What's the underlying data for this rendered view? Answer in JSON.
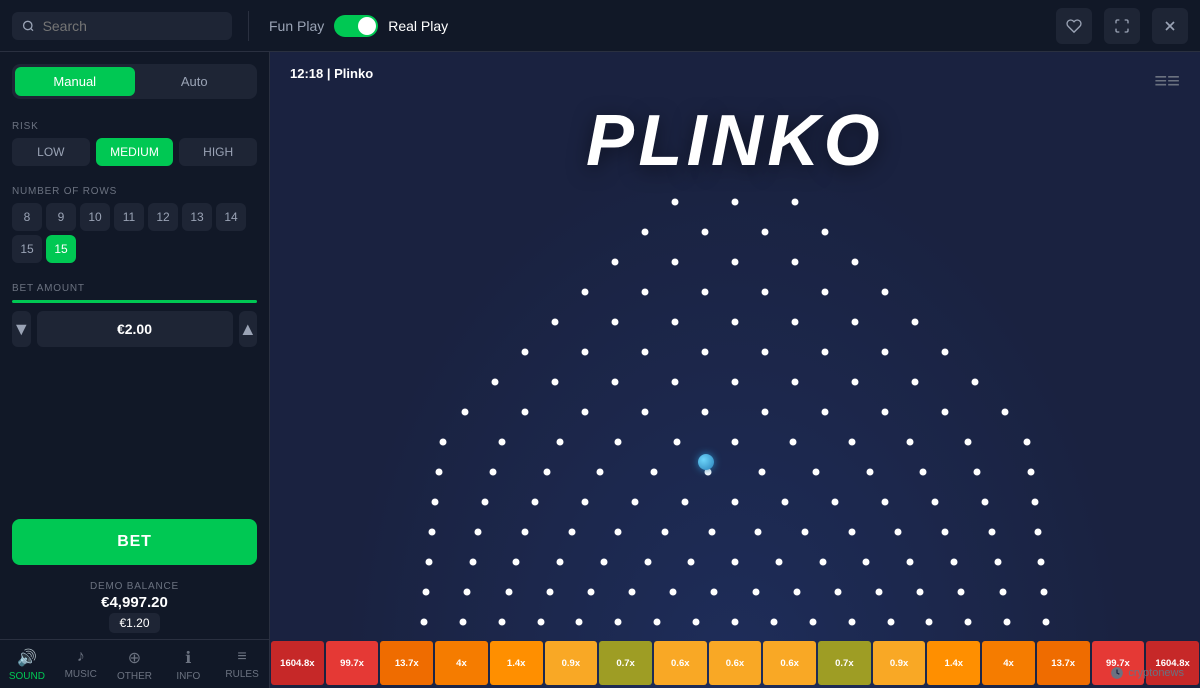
{
  "header": {
    "search_placeholder": "Search",
    "fun_play_label": "Fun Play",
    "real_play_label": "Real Play",
    "favorite_icon": "♥",
    "fullscreen_icon": "⛶",
    "close_icon": "✕"
  },
  "sidebar": {
    "manual_tab": "Manual",
    "auto_tab": "Auto",
    "risk_label": "RISK",
    "risk_options": [
      "LOW",
      "MEDIUM",
      "HIGH"
    ],
    "active_risk": "MEDIUM",
    "rows_label": "NUMBER OF ROWS",
    "row_options": [
      "8",
      "9",
      "10",
      "11",
      "12",
      "13",
      "14",
      "15",
      "15"
    ],
    "active_row": "15",
    "bet_amount_label": "BET AMOUNT",
    "bet_amount_value": "€2.00",
    "bet_button_label": "BET",
    "demo_balance_label": "DEMO BALANCE",
    "demo_balance_amount": "€4,997.20",
    "demo_badge": "€1.20",
    "nav_items": [
      {
        "label": "SOUND",
        "icon": "🔊"
      },
      {
        "label": "MUSIC",
        "icon": "♪"
      },
      {
        "label": "OTHER",
        "icon": "⊕"
      },
      {
        "label": "INFO",
        "icon": "ℹ"
      },
      {
        "label": "RULES",
        "icon": "≡"
      }
    ]
  },
  "game": {
    "time": "12:18",
    "title": "Plinko",
    "big_title": "PLINKO",
    "hash_icon": "≡"
  },
  "multipliers": [
    {
      "value": "1604.8x",
      "color": "red"
    },
    {
      "value": "99.7x",
      "color": "orange-red"
    },
    {
      "value": "13.7x",
      "color": "orange"
    },
    {
      "value": "4x",
      "color": "orange-light"
    },
    {
      "value": "1.4x",
      "color": "amber"
    },
    {
      "value": "0.9x",
      "color": "yellow"
    },
    {
      "value": "0.7x",
      "color": "yellow-green"
    },
    {
      "value": "0.6x",
      "color": "yellow"
    },
    {
      "value": "0.6x",
      "color": "yellow"
    },
    {
      "value": "0.6x",
      "color": "yellow"
    },
    {
      "value": "0.7x",
      "color": "yellow-green"
    },
    {
      "value": "0.9x",
      "color": "yellow"
    },
    {
      "value": "1.4x",
      "color": "amber"
    },
    {
      "value": "4x",
      "color": "orange-light"
    },
    {
      "value": "13.7x",
      "color": "orange"
    },
    {
      "value": "99.7x",
      "color": "orange-red"
    },
    {
      "value": "1604.8x",
      "color": "red"
    }
  ],
  "watermark": "cryptonews"
}
